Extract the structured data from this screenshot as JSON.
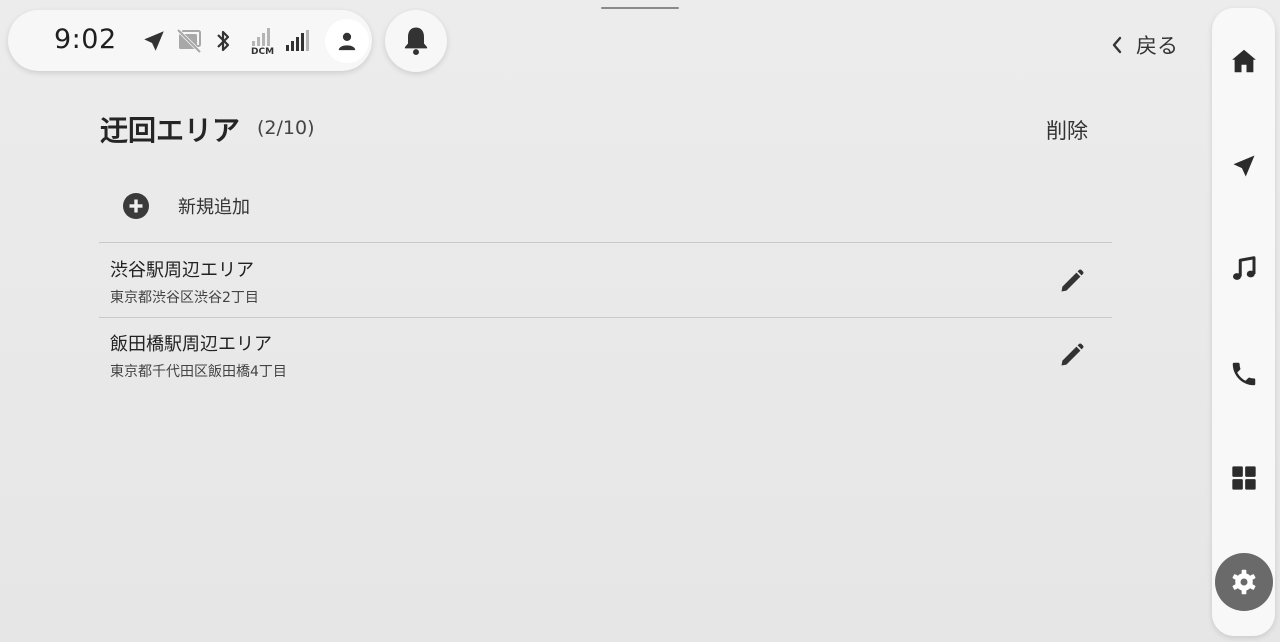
{
  "status_bar": {
    "time": "9:02",
    "signal_label": "DCM",
    "icons": [
      "navigation-arrow-icon",
      "screen-off-icon",
      "bluetooth-icon",
      "dcm-signal-icon",
      "cellular-signal-icon",
      "person-icon"
    ]
  },
  "notifications": {
    "icon": "bell-icon"
  },
  "header": {
    "back_label": "戻る",
    "title": "迂回エリア",
    "count": "(2/10)",
    "delete_label": "削除"
  },
  "add_new": {
    "label": "新規追加",
    "icon": "plus-circle-icon"
  },
  "areas": [
    {
      "name": "渋谷駅周辺エリア",
      "address": "東京都渋谷区渋谷2丁目"
    },
    {
      "name": "飯田橋駅周辺エリア",
      "address": "東京都千代田区飯田橋4丁目"
    }
  ],
  "side_nav": {
    "items": [
      "home",
      "navigation",
      "music",
      "phone",
      "apps",
      "settings"
    ],
    "active": "settings"
  },
  "colors": {
    "icon_dark": "#333333",
    "active_rail": "#6a6a6a",
    "divider": "#c9c9c9"
  }
}
